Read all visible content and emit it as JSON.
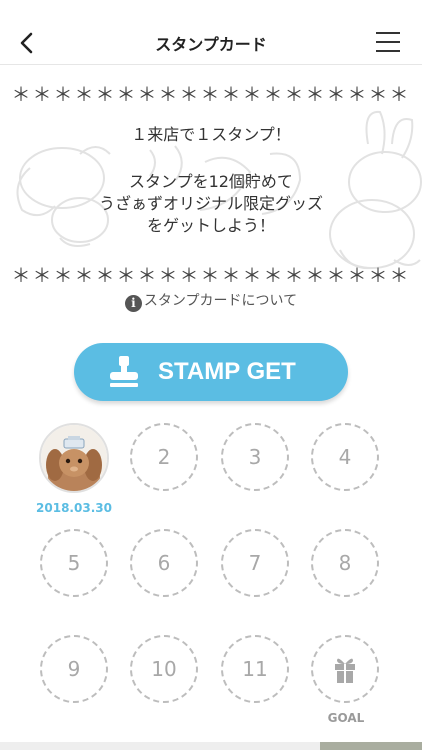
{
  "header": {
    "title": "スタンプカード"
  },
  "card": {
    "stars": "＊＊＊＊＊＊＊＊＊＊＊＊＊＊＊＊＊＊＊",
    "line1": "１来店で１スタンプ！",
    "line2": "スタンプを12個貯めて",
    "line3": "うざぁずオリジナル限定グッズ",
    "line4": "をゲットしよう！",
    "about_icon": "i",
    "about_text": "スタンプカードについて"
  },
  "stamp_button": {
    "label": "STAMP GET"
  },
  "stamps": {
    "first_date": "2018.03.30",
    "slots": [
      "2",
      "3",
      "4",
      "5",
      "6",
      "7",
      "8",
      "9",
      "10",
      "11"
    ],
    "goal_label": "GOAL"
  },
  "colors": {
    "accent": "#5bbde3",
    "slot_border": "#bdbdbd"
  }
}
